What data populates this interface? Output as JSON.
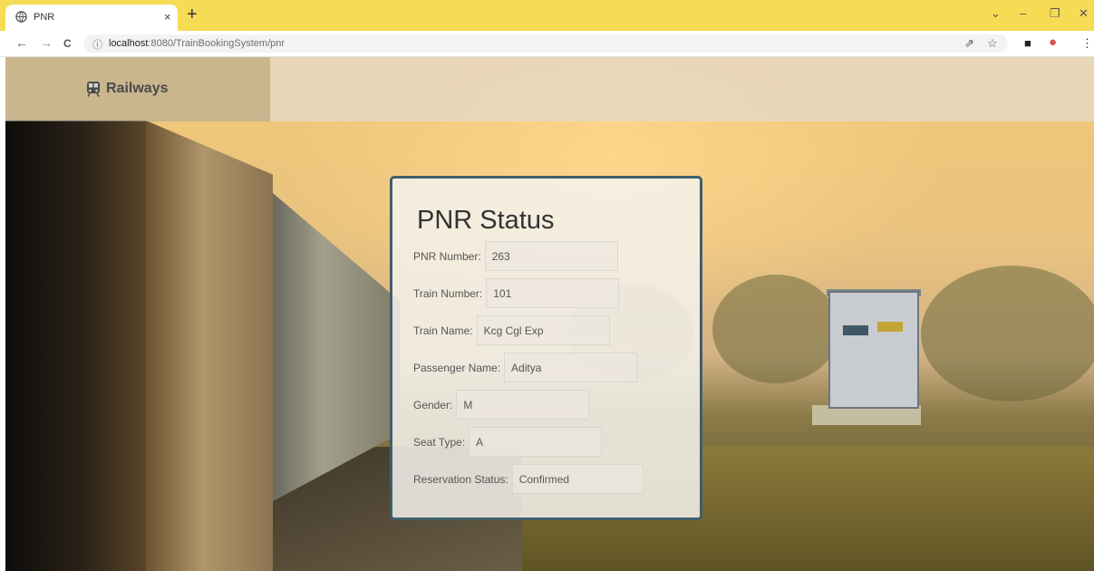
{
  "browser": {
    "tab_title": "PNR",
    "tab_close": "×",
    "new_tab": "+",
    "win_chevron": "⌄",
    "win_minimize": "–",
    "win_restore": "❐",
    "win_close": "✕",
    "back": "←",
    "forward": "→",
    "reload": "C",
    "url_info": "ⓘ",
    "url_host": "localhost",
    "url_path": ":8080/TrainBookingSystem/pnr",
    "share_icon": "⇗",
    "star_icon": "☆",
    "sidebar_icon": "■",
    "profile_icon": "●",
    "menu_icon": "⋮",
    "accent_color": "#f6dc55"
  },
  "navbar": {
    "brand_name": "Railways",
    "brand_icon": "train-icon"
  },
  "pnr": {
    "title": "PNR Status",
    "fields": [
      {
        "label": "PNR Number:",
        "value": "263"
      },
      {
        "label": "Train Number:",
        "value": "101"
      },
      {
        "label": "Train Name:",
        "value": "Kcg Cgl Exp"
      },
      {
        "label": "Passenger Name:",
        "value": "Aditya"
      },
      {
        "label": "Gender:",
        "value": "M"
      },
      {
        "label": "Seat Type:",
        "value": "A"
      },
      {
        "label": "Reservation Status:",
        "value": "Confirmed"
      }
    ]
  }
}
